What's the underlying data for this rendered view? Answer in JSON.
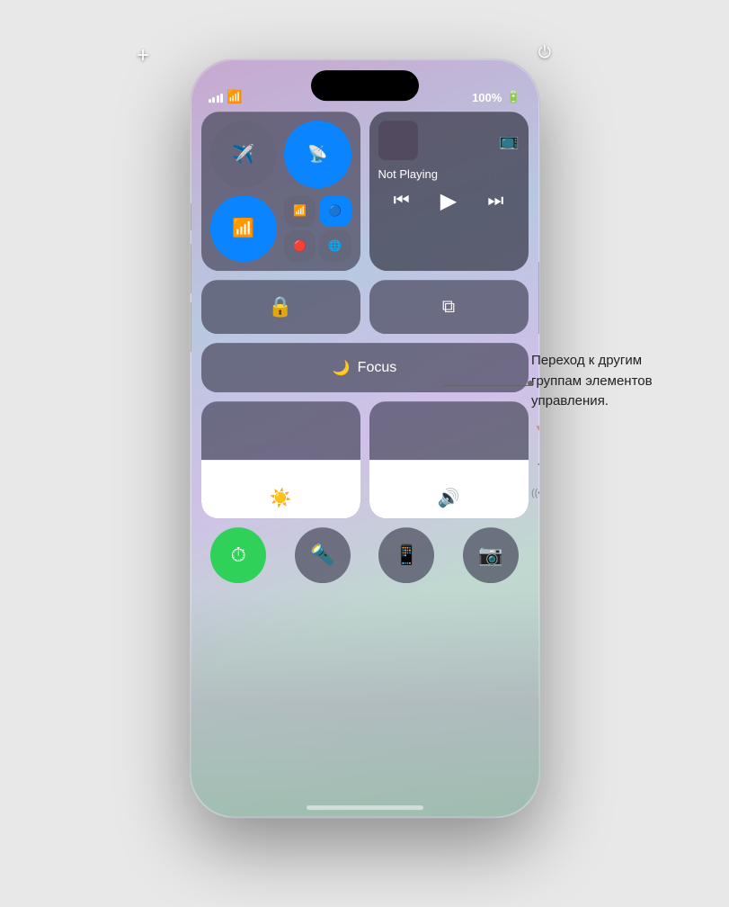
{
  "phone": {
    "status": {
      "battery": "100%",
      "time": ""
    },
    "top_left_icon": "+",
    "top_right_icon": "⏻"
  },
  "connectivity": {
    "airplane_mode": "✈",
    "wifi_calling": "📶",
    "wifi": "wifi",
    "cell_signal": "cell",
    "bluetooth": "bluetooth",
    "globe": "🌐"
  },
  "media": {
    "not_playing": "Not Playing",
    "airplay_icon": "aircast",
    "rewind": "⏮",
    "play": "▶",
    "forward": "⏭"
  },
  "controls": {
    "screen_lock": "🔒",
    "screen_mirror": "⧉",
    "focus_icon": "🌙",
    "focus_label": "Focus",
    "brightness_icon": "☀",
    "volume_icon": "🔊",
    "timer_icon": "⏱",
    "flashlight_icon": "🔦",
    "remote_icon": "📱",
    "camera_icon": "📷"
  },
  "annotation": {
    "text": "Переход к другим\nгруппам элементов\nуправления.",
    "line_visible": true
  },
  "side_icons": {
    "heart": "♥",
    "music": "♪",
    "signal": "((•))"
  }
}
